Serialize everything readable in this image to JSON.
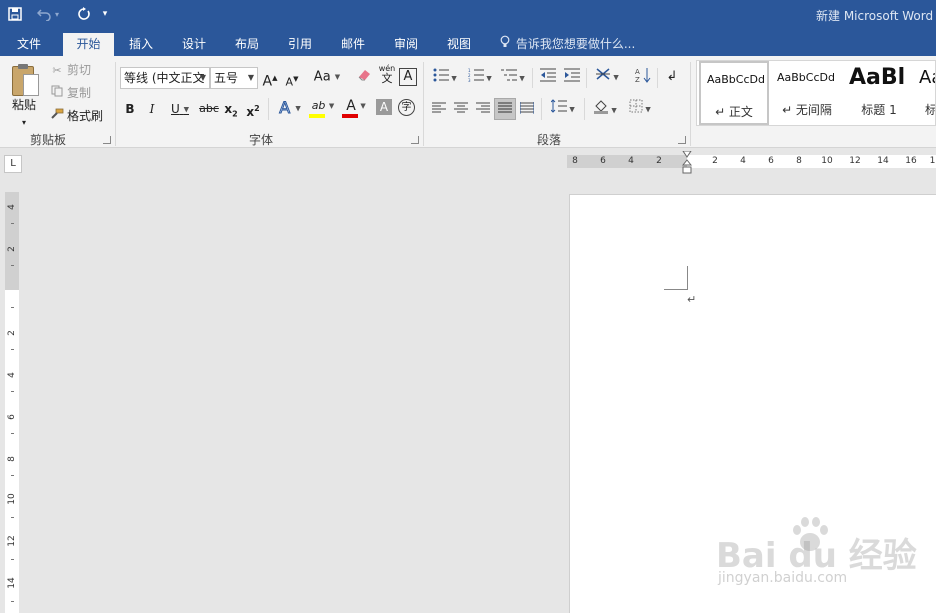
{
  "window": {
    "title": "新建 Microsoft Word"
  },
  "tabs": [
    {
      "label": "文件"
    },
    {
      "label": "开始"
    },
    {
      "label": "插入"
    },
    {
      "label": "设计"
    },
    {
      "label": "布局"
    },
    {
      "label": "引用"
    },
    {
      "label": "邮件"
    },
    {
      "label": "审阅"
    },
    {
      "label": "视图"
    }
  ],
  "tell_me": {
    "placeholder": "告诉我您想要做什么..."
  },
  "clipboard": {
    "paste": "粘贴",
    "cut": "剪切",
    "copy": "复制",
    "format_painter": "格式刷",
    "group_label": "剪贴板"
  },
  "font": {
    "family": "等线 (中文正文",
    "size": "五号",
    "grow": "A",
    "shrink": "A",
    "case": "Aa",
    "phonetic_top": "wén",
    "phonetic_bottom": "文",
    "border_char": "A",
    "bold": "B",
    "italic": "I",
    "underline": "U",
    "strike": "abc",
    "subscript_base": "x",
    "subscript": "2",
    "superscript_base": "x",
    "superscript": "2",
    "effects": "A",
    "highlight": "ab",
    "color": "A",
    "shading": "A",
    "enclose": "字",
    "group_label": "字体",
    "highlight_color": "#ffff00",
    "font_color": "#e00000"
  },
  "paragraph": {
    "group_label": "段落"
  },
  "styles": [
    {
      "sample": "AaBbCcDd",
      "name": "↵ 正文"
    },
    {
      "sample": "AaBbCcDd",
      "name": "↵ 无间隔"
    },
    {
      "sample": "AaBl",
      "name": "标题 1"
    },
    {
      "sample": "Aa",
      "name": "标"
    }
  ],
  "ruler": {
    "tab_selector": "L",
    "h_labels": [
      "8",
      "6",
      "4",
      "2",
      "2",
      "4",
      "6",
      "8",
      "10",
      "12",
      "14",
      "16",
      "1"
    ],
    "v_labels": [
      "4",
      "2",
      "2",
      "4",
      "6",
      "8",
      "10",
      "12",
      "14"
    ]
  },
  "document": {
    "paragraph_mark": "↵"
  },
  "watermark": {
    "main": "Bai  du 经验",
    "sub": "jingyan.baidu.com"
  }
}
